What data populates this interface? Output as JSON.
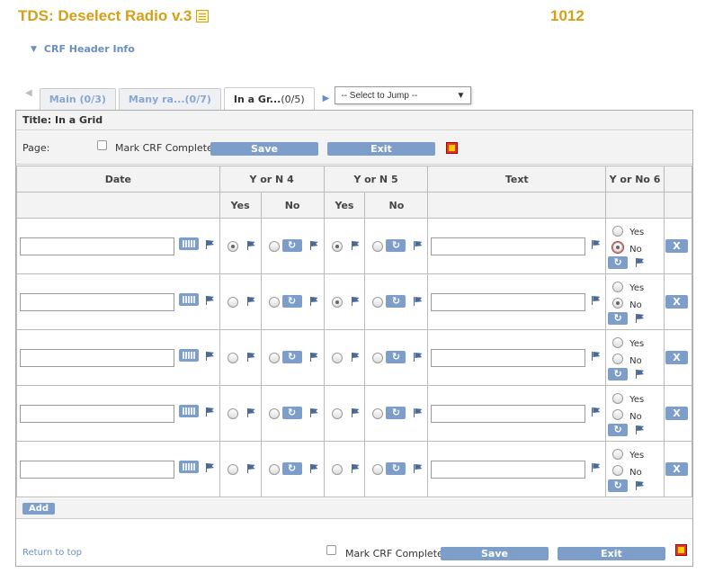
{
  "page": {
    "title": "TDS: Deselect Radio v.3",
    "subject_id": "1012"
  },
  "crf_header": {
    "label": "CRF Header Info"
  },
  "tabs": [
    {
      "label": "Main",
      "count": "(0/3)"
    },
    {
      "label": "Many ra...",
      "count": "(0/7)"
    },
    {
      "label": "In a Gr...",
      "count": "(0/5)"
    }
  ],
  "jump": {
    "selected": "-- Select to Jump --"
  },
  "section": {
    "title": "Title: In a Grid",
    "page_label": "Page:"
  },
  "actions": {
    "mark_complete": "Mark CRF Complete",
    "save": "Save",
    "exit": "Exit",
    "add": "Add",
    "return_top": "Return to top",
    "delete": "X"
  },
  "grid": {
    "headers": [
      "Date",
      "Y or N 4",
      "Y or N 5",
      "Text",
      "Y or No 6"
    ],
    "subheaders": [
      "Yes",
      "No",
      "Yes",
      "No"
    ],
    "radio_labels": {
      "yes": "Yes",
      "no": "No"
    },
    "rows": [
      {
        "yn4": "Yes",
        "yn5": "Yes",
        "yn6": "No"
      },
      {
        "yn4": "",
        "yn5": "Yes",
        "yn6": "No"
      },
      {
        "yn4": "",
        "yn5": "",
        "yn6": ""
      },
      {
        "yn4": "",
        "yn5": "",
        "yn6": ""
      },
      {
        "yn4": "",
        "yn5": "",
        "yn6": ""
      }
    ]
  },
  "colors": {
    "title": "#D4A017",
    "button": "#7c9ec9",
    "link": "#6a8fbf"
  },
  "icons": [
    "calendar-icon",
    "flag-icon",
    "reset-icon",
    "notes-icon",
    "print-icon"
  ]
}
